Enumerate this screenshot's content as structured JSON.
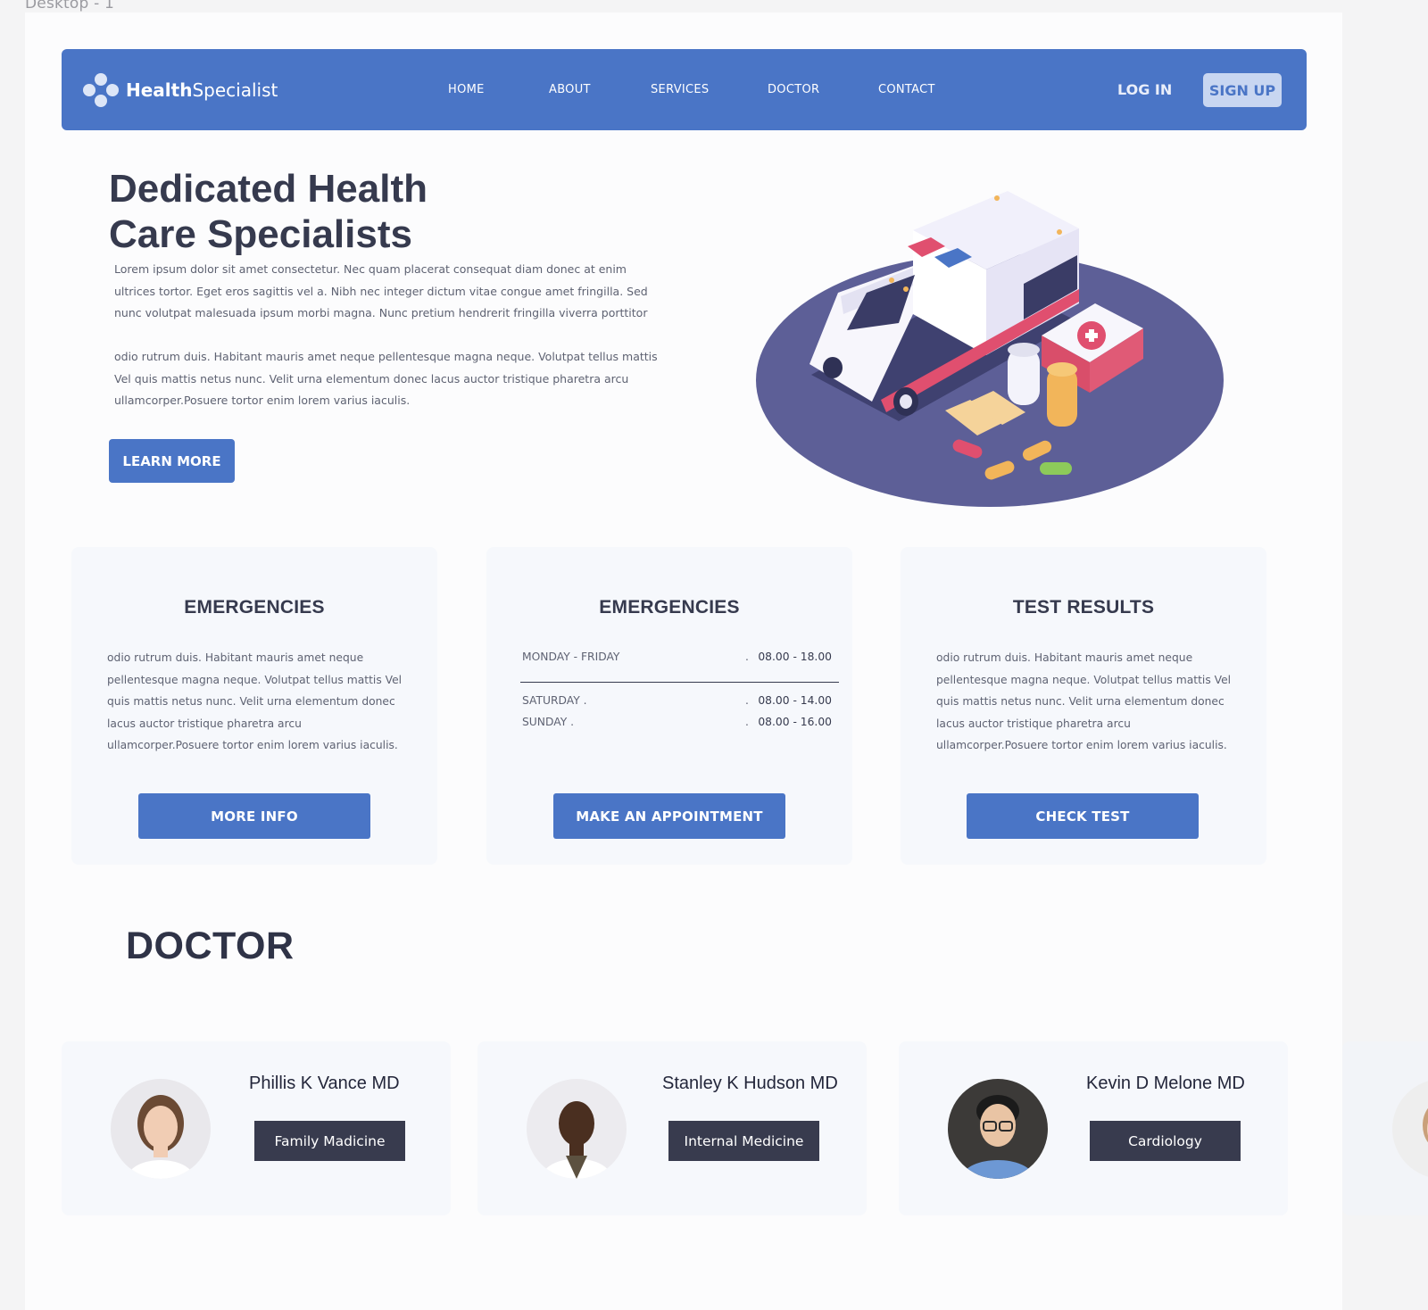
{
  "canvas_label": "Desktop - 1",
  "brand": {
    "name_bold": "Health",
    "name_regular": "Specialist"
  },
  "nav": {
    "links": [
      "HOME",
      "ABOUT",
      "SERVICES",
      "DOCTOR",
      "CONTACT"
    ],
    "login": "LOG IN",
    "signup": "SIGN UP"
  },
  "hero": {
    "title_line1": "Dedicated Health",
    "title_line2": "Care Specialists",
    "para1": "Lorem ipsum dolor sit amet consectetur. Nec quam placerat consequat diam donec at enim ultrices tortor. Eget eros sagittis vel a. Nibh nec integer dictum vitae congue amet fringilla. Sed nunc volutpat malesuada ipsum morbi magna. Nunc pretium hendrerit fringilla viverra porttitor",
    "para2": "odio rutrum duis. Habitant mauris amet neque pellentesque magna neque. Volutpat tellus mattis Vel quis mattis netus nunc. Velit urna elementum donec lacus auctor tristique pharetra arcu ullamcorper.Posuere tortor enim lorem varius iaculis.",
    "cta": "LEARN MORE"
  },
  "cards": [
    {
      "title": "EMERGENCIES",
      "text": "odio rutrum duis. Habitant mauris amet neque pellentesque magna neque. Volutpat tellus mattis Vel quis mattis netus nunc. Velit urna elementum donec lacus auctor tristique pharetra arcu ullamcorper.Posuere tortor enim lorem varius iaculis.",
      "button": "MORE INFO"
    },
    {
      "title": "EMERGENCIES",
      "hours": [
        {
          "day": "MONDAY - FRIDAY",
          "dot": ".",
          "time": "08.00 - 18.00"
        },
        {
          "day": "SATURDAY .",
          "dot": ".",
          "time": "08.00 - 14.00"
        },
        {
          "day": "SUNDAY .",
          "dot": ".",
          "time": "08.00 - 16.00"
        }
      ],
      "button": "MAKE AN APPOINTMENT"
    },
    {
      "title": "TEST RESULTS",
      "text": "odio rutrum duis. Habitant mauris amet neque pellentesque magna neque. Volutpat tellus mattis Vel quis mattis netus nunc. Velit urna elementum donec lacus auctor tristique pharetra arcu ullamcorper.Posuere tortor enim lorem varius iaculis.",
      "button": "CHECK TEST"
    }
  ],
  "doctor_section": {
    "title": "DOCTOR",
    "doctors": [
      {
        "name": "Phillis K Vance MD",
        "specialty": "Family Madicine"
      },
      {
        "name": "Stanley K Hudson MD",
        "specialty": "Internal Medicine"
      },
      {
        "name": "Kevin D Melone MD",
        "specialty": "Cardiology"
      }
    ]
  },
  "colors": {
    "primary": "#4a75c6",
    "dark": "#363a4e",
    "badge": "#383b4e",
    "card_bg": "#f6f8fc",
    "illustration_disc": "#5d5f97"
  }
}
